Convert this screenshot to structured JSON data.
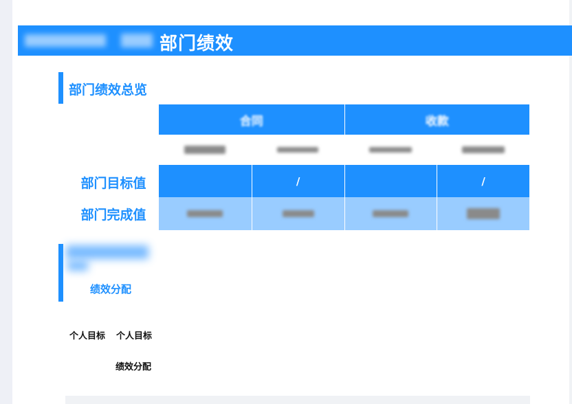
{
  "banner": {
    "title": "部门绩效"
  },
  "overview": {
    "section_title": "部门绩效总览",
    "head": [
      "合同",
      "收款"
    ],
    "subheaders": [
      "",
      "",
      "",
      ""
    ],
    "target_label": "部门目标值",
    "done_label": "部门完成值",
    "target_values": [
      "",
      "/",
      "",
      "/"
    ],
    "done_values": [
      "",
      "",
      "",
      ""
    ]
  },
  "distribution": {
    "section_title_partial": "绩效分配"
  },
  "personal": {
    "label_a": "个人目标",
    "label_b": "个人目标",
    "label_c": "绩效分配"
  },
  "colors": {
    "accent": "#1e90ff",
    "accent_light": "#99ccff"
  }
}
